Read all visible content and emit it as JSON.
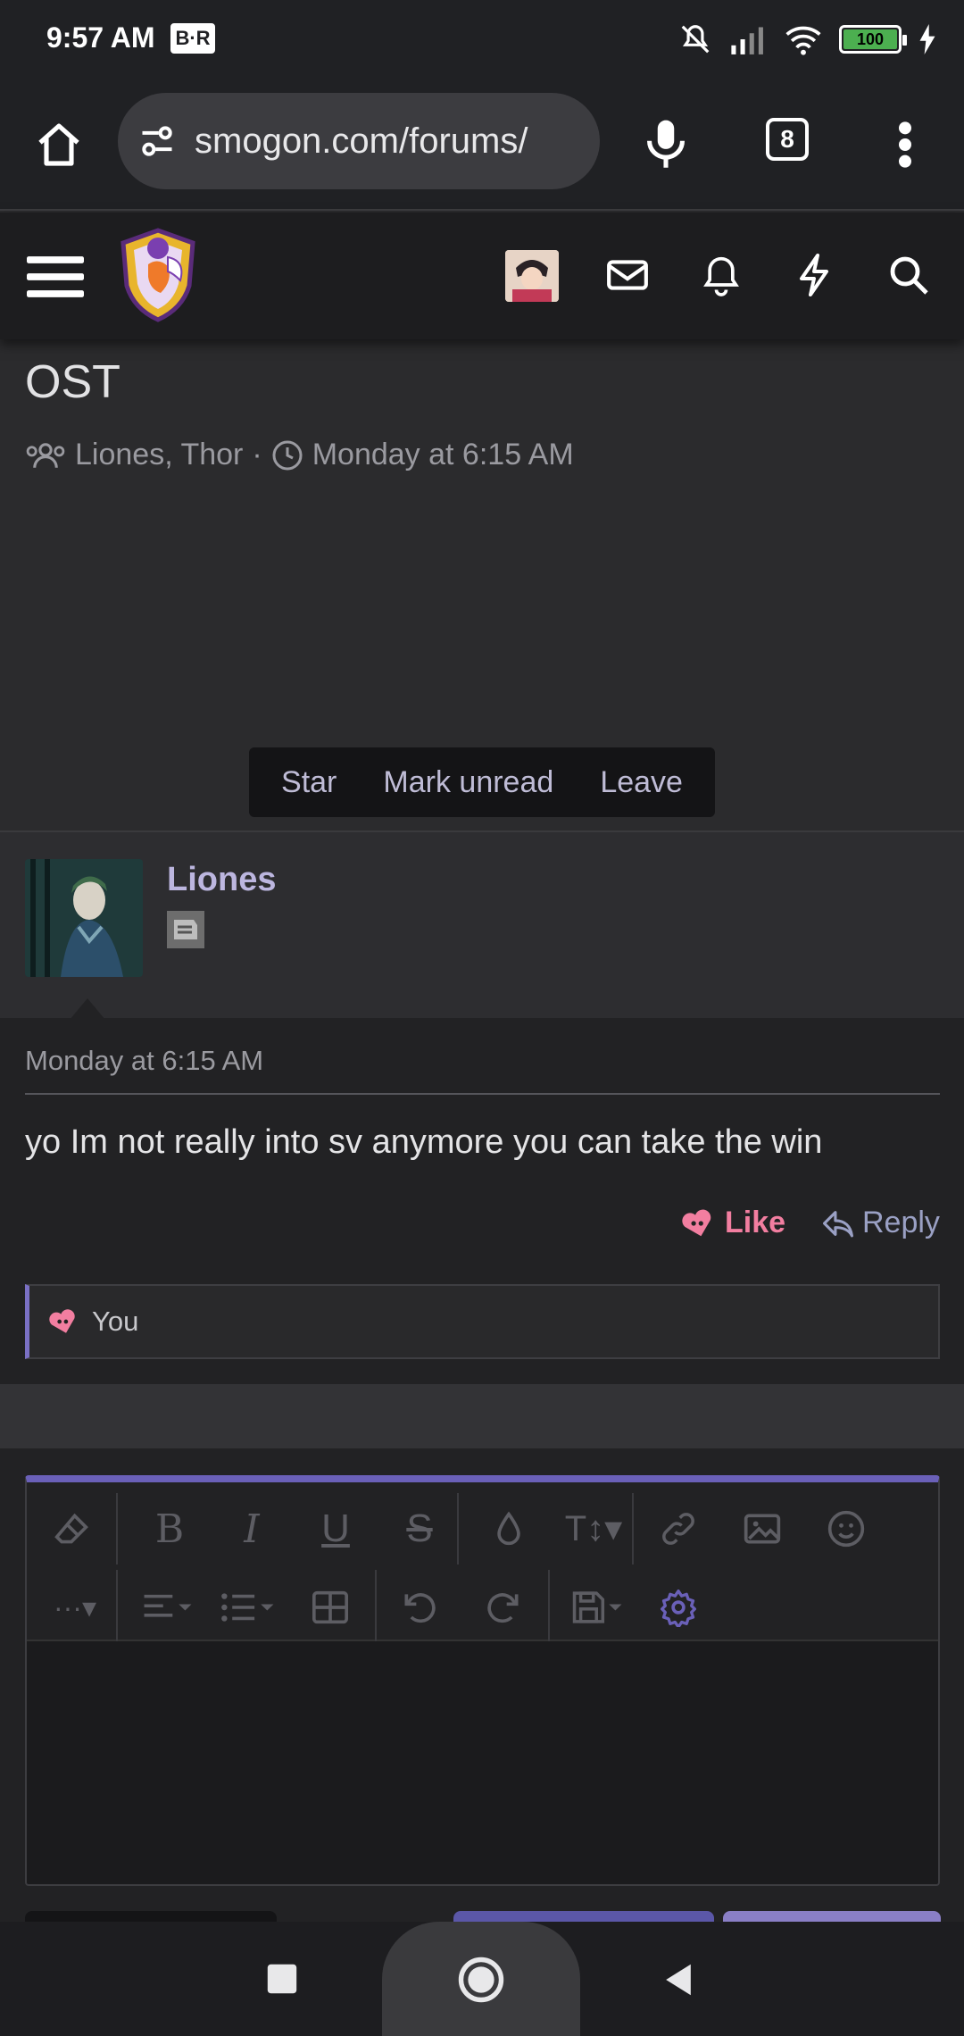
{
  "status": {
    "time": "9:57 AM",
    "carrier_badge": "B·R",
    "battery": "100"
  },
  "browser": {
    "url": "smogon.com/forums/",
    "tab_count": "8"
  },
  "conversation": {
    "title": "OST",
    "participants": "Liones, Thor",
    "separator": "·",
    "date": "Monday at 6:15 AM",
    "actions": [
      "Star",
      "Mark unread",
      "Leave"
    ]
  },
  "message": {
    "author": "Liones",
    "date": "Monday at 6:15 AM",
    "text": "yo Im not really into sv anymore you can take the win",
    "like_label": "Like",
    "reply_label": "Reply",
    "likes_by": "You"
  },
  "colors": {
    "accent": "#6a60b8",
    "like": "#f27ea0",
    "username": "#bcb6df"
  },
  "icons": [
    "home-icon",
    "site-settings-icon",
    "mic-icon",
    "tabs-icon",
    "more-icon",
    "menu-icon",
    "mail-icon",
    "bell-icon",
    "bolt-icon",
    "search-icon",
    "users-icon",
    "clock-icon",
    "heart-icon",
    "reply-icon",
    "eraser-icon",
    "bold-icon",
    "italic-icon",
    "underline-icon",
    "strike-icon",
    "color-icon",
    "text-size-icon",
    "link-icon",
    "image-icon",
    "smiley-icon",
    "more-options-icon",
    "align-icon",
    "list-icon",
    "table-icon",
    "undo-icon",
    "redo-icon",
    "save-icon",
    "gear-icon"
  ]
}
